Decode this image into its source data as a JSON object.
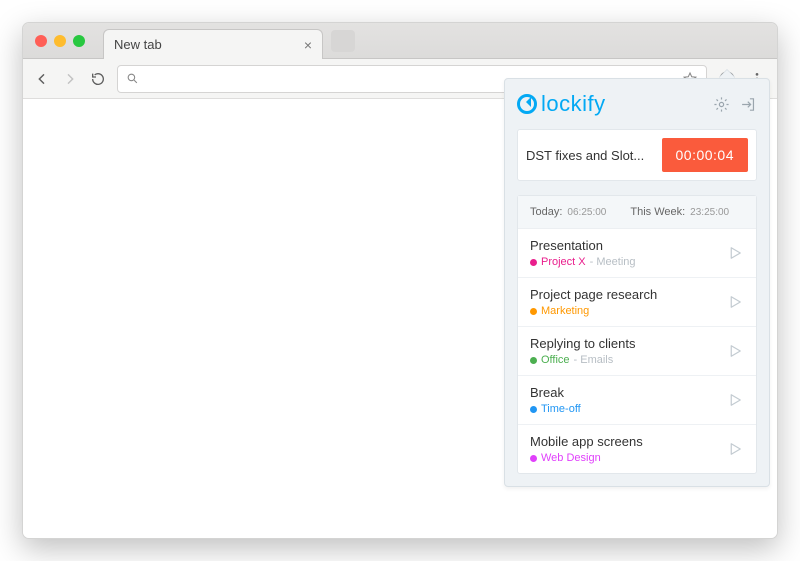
{
  "browser": {
    "tab_title": "New tab",
    "extension_name": "Clockify"
  },
  "popup": {
    "brand": "lockify",
    "current": {
      "title": "DST fixes and Slot...",
      "timer": "00:00:04"
    },
    "stats": {
      "today_label": "Today:",
      "today_value": "06:25:00",
      "week_label": "This Week:",
      "week_value": "23:25:00"
    },
    "entries": [
      {
        "title": "Presentation",
        "project": "Project X",
        "tag": "Meeting",
        "color": "#e91e8c"
      },
      {
        "title": "Project page research",
        "project": "Marketing",
        "tag": "",
        "color": "#ff9800"
      },
      {
        "title": "Replying to clients",
        "project": "Office",
        "tag": "Emails",
        "color": "#4caf50"
      },
      {
        "title": "Break",
        "project": "Time-off",
        "tag": "",
        "color": "#2196f3"
      },
      {
        "title": "Mobile app screens",
        "project": "Web Design",
        "tag": "",
        "color": "#e040fb"
      }
    ]
  }
}
